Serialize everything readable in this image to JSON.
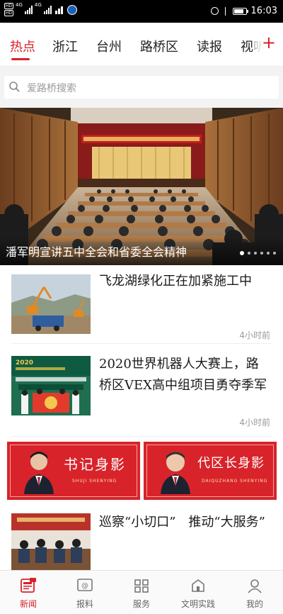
{
  "status_bar": {
    "sim1": "HD",
    "sim2": "HD",
    "net1": "4G",
    "net2": "4G",
    "time": "16:03",
    "battery_level": 0.8
  },
  "tabs": [
    {
      "label": "热点",
      "active": true
    },
    {
      "label": "浙江",
      "active": false
    },
    {
      "label": "台州",
      "active": false
    },
    {
      "label": "路桥区",
      "active": false
    },
    {
      "label": "读报",
      "active": false
    },
    {
      "label": "视听",
      "active": false
    }
  ],
  "add_channel_label": "+",
  "search": {
    "placeholder": "爱路桥搜索"
  },
  "hero": {
    "title": "潘军明宣讲五中全会和省委全会精神",
    "slide_count": 6,
    "active_slide": 1
  },
  "news": [
    {
      "title": "飞龙湖绿化正在加紧施工中",
      "time": "4小时前",
      "thumb_icon": "excavator-photo"
    },
    {
      "title": "2020世界机器人大赛上，路桥区VEX高中组项目勇夺季军",
      "time": "4小时前",
      "thumb_icon": "robot-contest-photo",
      "thumb_text": "2020"
    },
    {
      "title": "巡察“小切口”　推动“大服务”",
      "time": "",
      "thumb_icon": "meeting-photo"
    }
  ],
  "banners": [
    {
      "title": "书记身影",
      "subtitle": "SHUJI SHENYING"
    },
    {
      "title": "代区长身影",
      "subtitle": "DAIQUZHANG SHENYING"
    }
  ],
  "bottom_nav": [
    {
      "label": "新闻",
      "icon": "newspaper-icon",
      "active": true
    },
    {
      "label": "报料",
      "icon": "report-icon",
      "active": false
    },
    {
      "label": "服务",
      "icon": "service-icon",
      "active": false
    },
    {
      "label": "文明实践",
      "icon": "civilization-icon",
      "active": false
    },
    {
      "label": "我的",
      "icon": "profile-icon",
      "active": false
    }
  ],
  "colors": {
    "accent": "#d8202a",
    "banner_red": "#d8232a"
  }
}
